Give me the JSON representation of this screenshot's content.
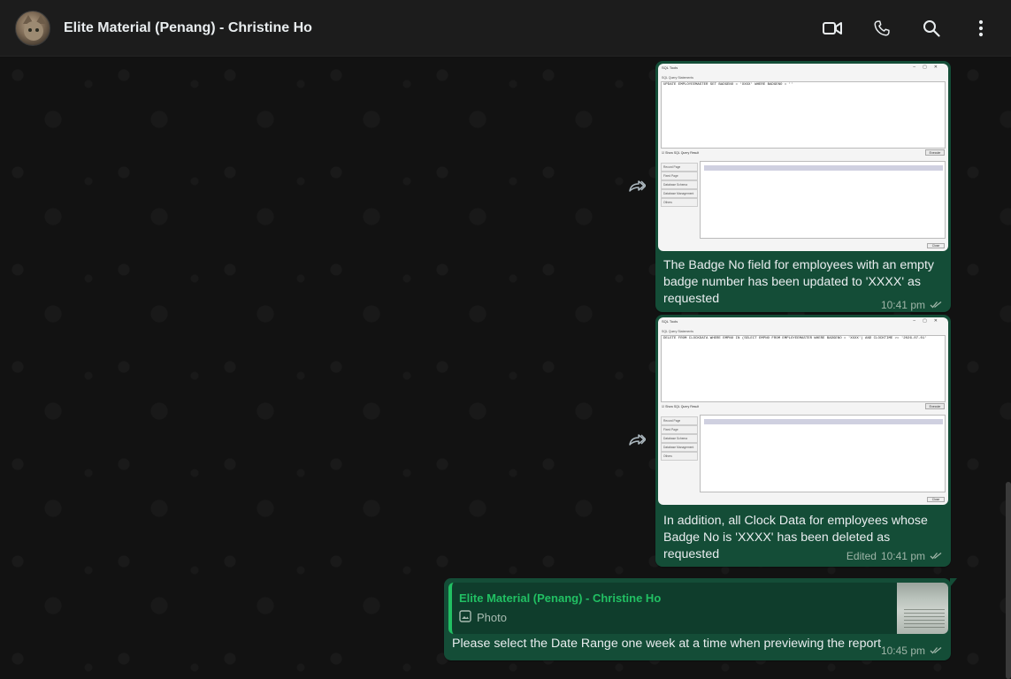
{
  "header": {
    "contact_name": "Elite Material (Penang) - Christine Ho",
    "icons": [
      "video-call-icon",
      "voice-call-icon",
      "search-icon",
      "menu-icon"
    ]
  },
  "messages": [
    {
      "type": "image-with-caption",
      "image": {
        "window_title": "SQL Tools",
        "fieldset_label": "SQL Query Statements",
        "sql": "UPDATE EMPLOYEEMASTER SET BADGENO = 'XXXX' WHERE BADGENO = ''",
        "checkbox_label": "Show SQL Query Result",
        "execute_label": "Execute",
        "side_items": [
          "Record Page",
          "Fixed Page",
          "Database Schema",
          "Database Management",
          "Others"
        ],
        "close_label": "Close"
      },
      "caption": "The Badge No field for employees with an empty badge number has been updated to 'XXXX' as requested",
      "time": "10:41 pm",
      "status": "read"
    },
    {
      "type": "image-with-caption",
      "image": {
        "window_title": "SQL Tools",
        "fieldset_label": "SQL Query Statements",
        "sql": "DELETE FROM CLOCKDATA WHERE EMPNO IN (SELECT EMPNO FROM EMPLOYEEMASTER WHERE BADGENO = 'XXXX') AND CLOCKTIME >= '2026-07-01'",
        "checkbox_label": "Show SQL Query Result",
        "execute_label": "Execute",
        "side_items": [
          "Record Page",
          "Fixed Page",
          "Database Schema",
          "Database Management",
          "Others"
        ],
        "close_label": "Close"
      },
      "caption": "In addition, all Clock Data for employees whose Badge No is 'XXXX' has been deleted as requested",
      "edited_label": "Edited",
      "time": "10:41 pm",
      "status": "read"
    },
    {
      "type": "reply",
      "quote": {
        "author": "Elite Material (Penang) - Christine Ho",
        "media_label": "Photo"
      },
      "text": "Please select the Date Range one week at a time when previewing the report",
      "time": "10:45 pm",
      "status": "read"
    }
  ],
  "colors": {
    "header_bg": "#1c1c1c",
    "chat_bg": "#121212",
    "outgoing_bubble": "#144d37",
    "accent": "#21c063"
  }
}
